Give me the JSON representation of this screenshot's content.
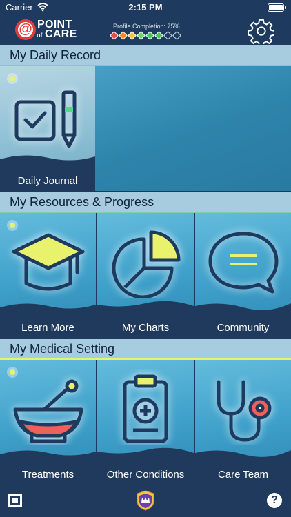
{
  "status_bar": {
    "carrier": "Carrier",
    "time": "2:15 PM"
  },
  "header": {
    "logo_mark": "@",
    "logo_point": "POINT",
    "logo_of": "of",
    "logo_care": "CARE",
    "profile_completion_label": "Profile Completion: 75%",
    "profile_completion": 0.75,
    "diamond_colors": [
      "#e84c4c",
      "#f28c28",
      "#f5c542",
      "#6fd46a",
      "#46c85a",
      "#46c85a",
      "none",
      "none"
    ],
    "settings_icon": "gear-icon"
  },
  "sections": [
    {
      "title": "My Daily Record",
      "tiles": [
        {
          "label": "Daily Journal",
          "icon": "checkbox-pencil-icon",
          "selected": true
        }
      ]
    },
    {
      "title": "My Resources & Progress",
      "tiles": [
        {
          "label": "Learn More",
          "icon": "graduation-cap-icon"
        },
        {
          "label": "My Charts",
          "icon": "pie-chart-icon"
        },
        {
          "label": "Community",
          "icon": "speech-bubble-icon"
        }
      ]
    },
    {
      "title": "My Medical Setting",
      "tiles": [
        {
          "label": "Treatments",
          "icon": "mortar-pestle-icon"
        },
        {
          "label": "Other Conditions",
          "icon": "clipboard-medical-icon"
        },
        {
          "label": "Care Team",
          "icon": "stethoscope-icon"
        }
      ]
    }
  ],
  "bottom_bar": {
    "left_icon": "qr-code-icon",
    "center_icon": "crown-badge-icon",
    "help_label": "?"
  },
  "colors": {
    "navy": "#1f3a5c",
    "section_bar": "#a7ccdf",
    "accent_yellow": "#e9f26c",
    "accent_red": "#f0605a",
    "accent_green": "#4fd98a"
  }
}
